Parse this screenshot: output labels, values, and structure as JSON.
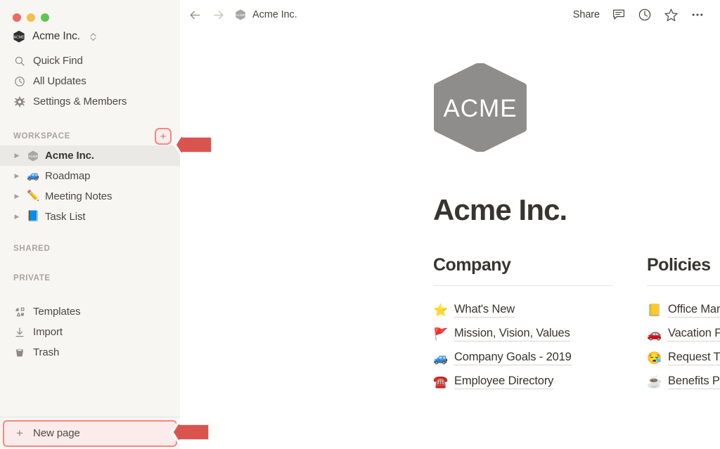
{
  "window": {
    "traffic_lights": [
      {
        "name": "close",
        "color": "#ed6a5e"
      },
      {
        "name": "minimize",
        "color": "#f4bf4f"
      },
      {
        "name": "maximize",
        "color": "#61c554"
      }
    ]
  },
  "sidebar": {
    "workspace_name": "Acme Inc.",
    "workspace_logo_text": "ACME",
    "nav_items": [
      {
        "label": "Quick Find",
        "icon": "search-icon"
      },
      {
        "label": "All Updates",
        "icon": "clock-icon"
      },
      {
        "label": "Settings & Members",
        "icon": "gear-icon"
      }
    ],
    "sections": [
      {
        "title": "WORKSPACE",
        "has_add_button": true,
        "add_label": "+"
      },
      {
        "title": "SHARED",
        "has_add_button": false
      },
      {
        "title": "PRIVATE",
        "has_add_button": false
      }
    ],
    "workspace_pages": [
      {
        "label": "Acme Inc.",
        "emoji": "",
        "icon": "acme-hexagon-icon",
        "selected": true
      },
      {
        "label": "Roadmap",
        "emoji": "🚙",
        "selected": false
      },
      {
        "label": "Meeting Notes",
        "emoji": "✏️",
        "selected": false
      },
      {
        "label": "Task List",
        "emoji": "📘",
        "selected": false
      }
    ],
    "utility_items": [
      {
        "label": "Templates",
        "icon": "templates-icon"
      },
      {
        "label": "Import",
        "icon": "import-download-icon"
      },
      {
        "label": "Trash",
        "icon": "trash-icon"
      }
    ],
    "new_page": {
      "label": "New page",
      "plus": "+"
    }
  },
  "topbar": {
    "back_label": "back",
    "forward_label": "forward",
    "breadcrumb": "Acme Inc.",
    "share_label": "Share",
    "icons": [
      {
        "name": "comment-icon"
      },
      {
        "name": "clock-history-icon"
      },
      {
        "name": "star-favorite-icon"
      },
      {
        "name": "more-options-icon"
      }
    ]
  },
  "main": {
    "logo_text": "ACME",
    "title": "Acme Inc.",
    "columns": [
      {
        "heading": "Company",
        "links": [
          {
            "emoji": "⭐",
            "label": "What's New"
          },
          {
            "emoji": "🚩",
            "label": "Mission, Vision, Values"
          },
          {
            "emoji": "🚙",
            "label": "Company Goals - 2019"
          },
          {
            "emoji": "☎️",
            "label": "Employee Directory"
          }
        ]
      },
      {
        "heading": "Policies",
        "links": [
          {
            "emoji": "📒",
            "label": "Office Manual"
          },
          {
            "emoji": "🚗",
            "label": "Vacation Policy"
          },
          {
            "emoji": "😪",
            "label": "Request Time Off"
          },
          {
            "emoji": "☕",
            "label": "Benefits Policies"
          }
        ]
      }
    ]
  },
  "annotations": {
    "accent_color": "#d9534f",
    "highlight_border": "#ef8a86",
    "arrows": [
      {
        "name": "arrow-to-add-page-button",
        "direction": "left"
      },
      {
        "name": "arrow-to-new-page-button",
        "direction": "left"
      }
    ]
  }
}
